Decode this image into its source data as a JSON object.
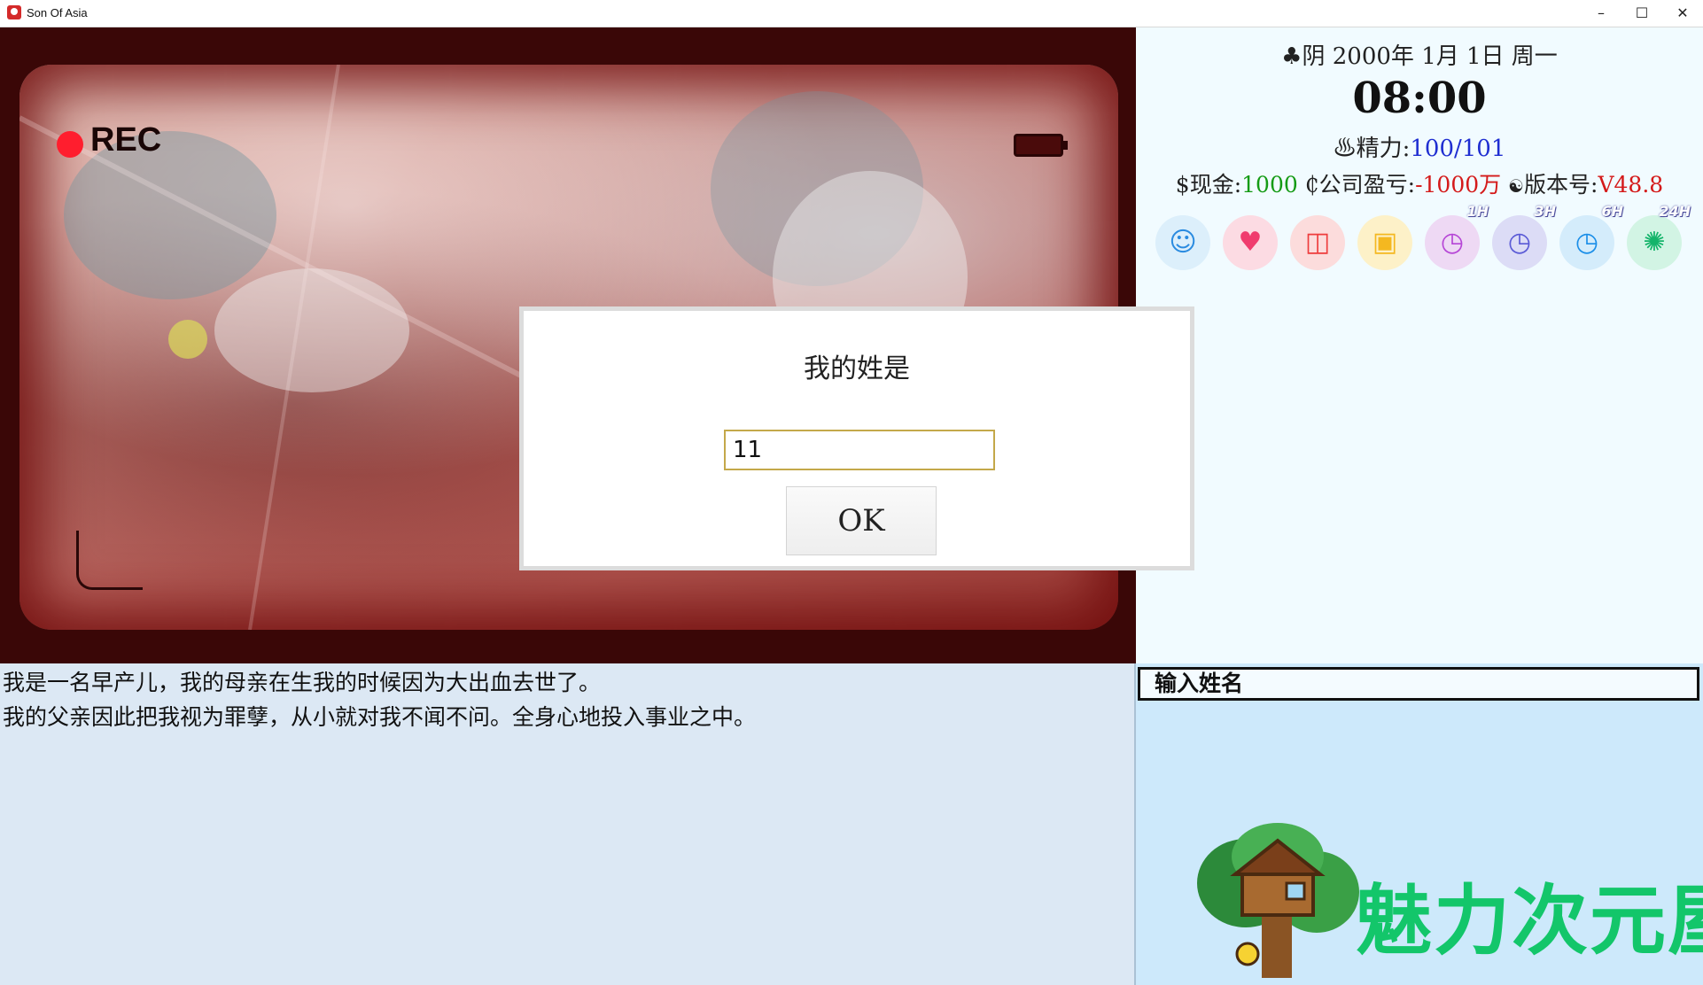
{
  "window": {
    "title": "Son Of Asia",
    "minimize_glyph": "–",
    "maximize_glyph": "☐",
    "close_glyph": "✕"
  },
  "scene": {
    "rec_label": "REC"
  },
  "dialog": {
    "prompt": "我的姓是",
    "input_value": "11",
    "ok_label": "OK"
  },
  "status": {
    "weather_icon": "♣",
    "weather": "阴",
    "date": "2000年 1月 1日 周一",
    "time": "08:00",
    "energy_icon": "♨",
    "energy_label": "精力:",
    "energy_current": "100",
    "energy_separator": "/",
    "energy_max": "101",
    "cash_label": "$现金:",
    "cash_value": "1000",
    "company_label": "₵公司盈亏:",
    "company_value": "-1000万",
    "version_label": "版本号:",
    "version_value": "V48.8"
  },
  "toolbar": {
    "icons": [
      {
        "name": "user-icon",
        "color": "#dceffb",
        "glyph_color": "#2a8be0"
      },
      {
        "name": "heart-icon",
        "color": "#fcdbe3",
        "glyph_color": "#f03c6e"
      },
      {
        "name": "shopping-bag-icon",
        "color": "#fcdcdc",
        "glyph_color": "#ee3c3c"
      },
      {
        "name": "save-icon",
        "color": "#fdf1c8",
        "glyph_color": "#f4b820"
      },
      {
        "name": "clock-1h-icon",
        "badge": "1H",
        "color": "#eed9f4",
        "glyph_color": "#b646d6"
      },
      {
        "name": "clock-3h-icon",
        "badge": "3H",
        "color": "#dcdcf6",
        "glyph_color": "#5a5ad6"
      },
      {
        "name": "clock-6h-icon",
        "badge": "6H",
        "color": "#d4ecfb",
        "glyph_color": "#1a8ee8"
      },
      {
        "name": "camera-shutter-24h-icon",
        "badge": "24H",
        "color": "#d2f4e4",
        "glyph_color": "#14b46a"
      }
    ]
  },
  "story": {
    "lines": [
      "我是一名早产儿，我的母亲在生我的时候因为大出血去世了。",
      "我的父亲因此把我视为罪孽，从小就对我不闻不问。全身心地投入事业之中。"
    ]
  },
  "side_panel": {
    "header": "输入姓名",
    "logo_text": "魅力次元屋"
  }
}
